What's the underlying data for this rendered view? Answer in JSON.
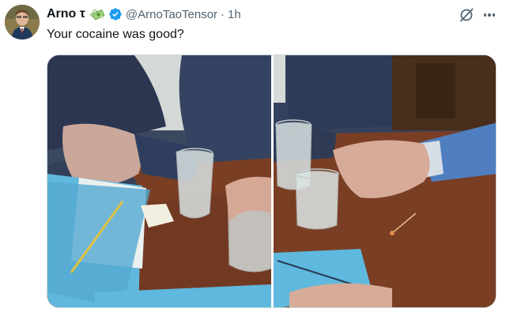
{
  "tweet": {
    "author_name": "Arno τ",
    "handle": "@ArnoTaoTensor",
    "separator": "·",
    "time": "1h",
    "text": "Your cocaine was good?",
    "author_emoji": "money-with-wings-emoji",
    "verified_badge": "verified-icon"
  },
  "actions": {
    "grok_icon": "grok-icon",
    "more_icon": "more-icon"
  },
  "colors": {
    "text": "#0f1419",
    "secondary": "#536471",
    "verified": "#1d9bf0",
    "border": "#cfd9de"
  }
}
